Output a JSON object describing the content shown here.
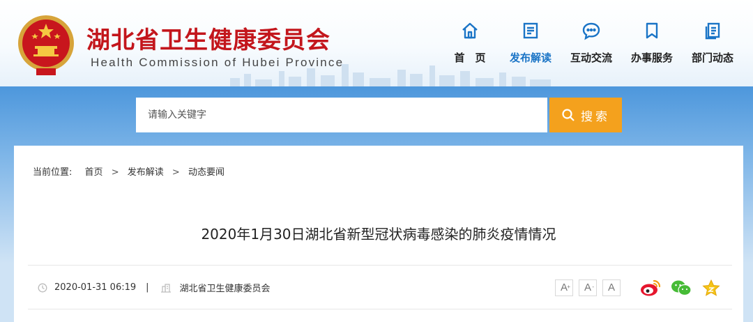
{
  "header": {
    "title": "湖北省卫生健康委员会",
    "subtitle": "Health Commission of Hubei Province"
  },
  "nav": [
    {
      "label": "首　页",
      "icon": "home-icon"
    },
    {
      "label": "发布解读",
      "icon": "document-icon"
    },
    {
      "label": "互动交流",
      "icon": "chat-icon"
    },
    {
      "label": "办事服务",
      "icon": "bookmark-icon"
    },
    {
      "label": "部门动态",
      "icon": "pages-icon"
    }
  ],
  "nav_active_index": 1,
  "search": {
    "placeholder": "请输入关键字",
    "button_label": "搜索"
  },
  "breadcrumb": {
    "prefix": "当前位置:",
    "items": [
      "首页",
      "发布解读",
      "动态要闻"
    ],
    "separator": ">"
  },
  "article": {
    "title": "2020年1月30日湖北省新型冠状病毒感染的肺炎疫情情况",
    "date": "2020-01-31 06:19",
    "divider": "|",
    "source": "湖北省卫生健康委员会"
  },
  "font_controls": [
    "A",
    "A",
    "A"
  ],
  "share": [
    "weibo-icon",
    "wechat-icon",
    "favorite-icon"
  ],
  "colors": {
    "brand_red": "#c3161c",
    "nav_active": "#1a74c6",
    "search_button": "#f4a11d",
    "band_blue": "#4d97dc"
  }
}
